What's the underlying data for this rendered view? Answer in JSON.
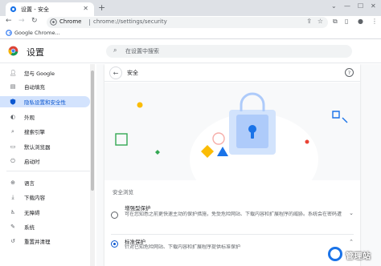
{
  "tab": {
    "title": "设置 - 安全"
  },
  "omnibox": {
    "chip": "Chrome",
    "url": "chrome://settings/security"
  },
  "bookmarks": {
    "items": [
      {
        "label": "Google Chrome..."
      }
    ]
  },
  "header": {
    "title": "设置",
    "search_placeholder": "在设置中搜索"
  },
  "sidebar": {
    "items": [
      {
        "label": "您与 Google",
        "icon": "person-icon"
      },
      {
        "label": "自动填充",
        "icon": "clipboard-icon"
      },
      {
        "label": "隐私设置和安全性",
        "icon": "shield-icon",
        "active": true
      },
      {
        "label": "外观",
        "icon": "palette-icon"
      },
      {
        "label": "搜索引擎",
        "icon": "search-icon"
      },
      {
        "label": "默认浏览器",
        "icon": "browser-icon"
      },
      {
        "label": "启动时",
        "icon": "power-icon"
      },
      {
        "label": "语言",
        "icon": "globe-icon"
      },
      {
        "label": "下载内容",
        "icon": "download-icon"
      },
      {
        "label": "无障碍",
        "icon": "accessibility-icon"
      },
      {
        "label": "系统",
        "icon": "wrench-icon"
      },
      {
        "label": "重置并清理",
        "icon": "reset-icon"
      }
    ]
  },
  "page": {
    "title": "安全",
    "section_label": "安全浏览",
    "options": [
      {
        "title": "增强型保护",
        "desc": "针对已知危险网站、下载内容和扩展程序提供标准保护",
        "desc_full": "可在您知悉之前更快速主动的保护措施，免受危险网站、下载内容和扩展程序的威胁。系统会在密码遭遇数据泄露时向您发出警告，需要将浏览数据发送给 Google",
        "checked": false
      },
      {
        "title": "标准保护",
        "desc": "针对已知危险网站、下载内容和扩展程序提供标准保护",
        "checked": true
      }
    ]
  },
  "watermark": {
    "text": "管理站"
  },
  "colors": {
    "accent": "#0b57d0",
    "active_bg": "#d3e3fd",
    "toolbar": "#dee1e6"
  }
}
